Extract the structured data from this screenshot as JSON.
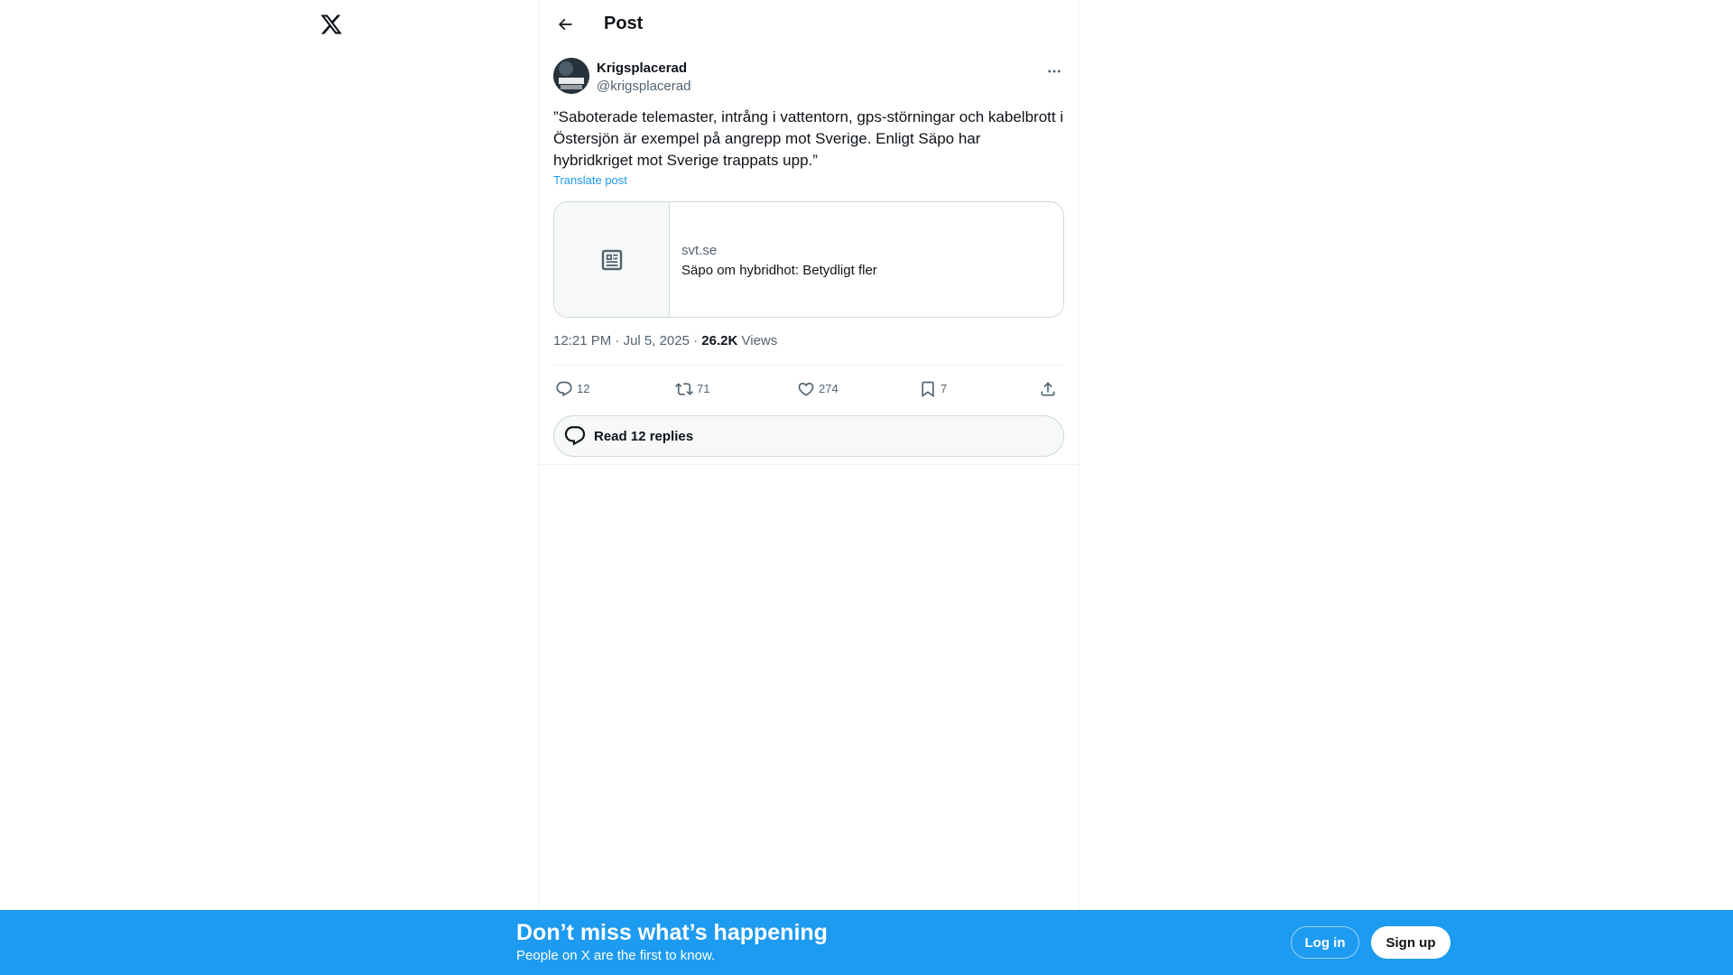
{
  "app": {
    "logo_icon": "x-logo-icon"
  },
  "header": {
    "back_icon": "arrow-left-icon",
    "title": "Post"
  },
  "post": {
    "author": {
      "name": "Krigsplacerad",
      "handle": "@krigsplacerad",
      "avatar_text": "ÖVER-LEVNAD"
    },
    "more_icon": "more-horizontal-icon",
    "text": "”Saboterade telemaster, intrång i vattentorn, gps-störningar och kabelbrott i Östersjön är exempel på angrepp mot Sverige. Enligt Säpo har hybridkriget mot Sverige trappats upp.”",
    "translate_label": "Translate post",
    "link_card": {
      "icon": "newspaper-icon",
      "domain": "svt.se",
      "title": "Säpo om hybridhot: Betydligt fler"
    },
    "meta": {
      "time": "12:21 PM",
      "separator": "·",
      "date": "Jul 5, 2025",
      "views_count": "26.2K",
      "views_label": "Views"
    },
    "actions": {
      "reply": {
        "icon": "reply-icon",
        "count": "12"
      },
      "repost": {
        "icon": "repost-icon",
        "count": "71"
      },
      "like": {
        "icon": "heart-icon",
        "count": "274"
      },
      "bookmark": {
        "icon": "bookmark-icon",
        "count": "7"
      },
      "share": {
        "icon": "share-icon"
      }
    },
    "read_replies": {
      "icon": "replies-bubble-icon",
      "label": "Read 12 replies"
    }
  },
  "banner": {
    "title": "Don’t miss what’s happening",
    "subtitle": "People on X are the first to know.",
    "login_label": "Log in",
    "signup_label": "Sign up",
    "background_color": "#1d9bf0"
  }
}
